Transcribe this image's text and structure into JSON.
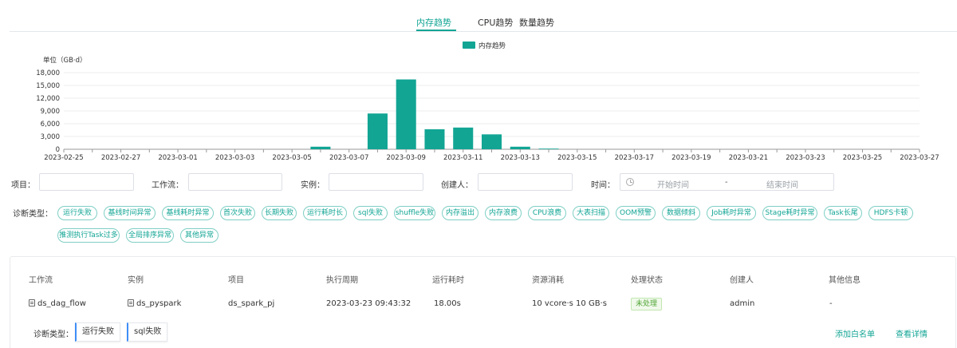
{
  "tabs": [
    {
      "label": "内存趋势"
    },
    {
      "label": "CPU趋势"
    },
    {
      "label": "数量趋势"
    }
  ],
  "colors": {
    "accent": "#12a594",
    "bar": "#12a594",
    "status_ok": "#52a538",
    "chip_border": "#3e8ef7"
  },
  "chart_data": {
    "type": "bar",
    "title": "",
    "legend": [
      "内存趋势"
    ],
    "legend_position": "top-center",
    "ylabel": "单位（GB·d）",
    "ylim": [
      0,
      18000
    ],
    "yticks": [
      "18,000",
      "15,000",
      "12,000",
      "9,000",
      "6,000",
      "3,000",
      "0"
    ],
    "grid": true,
    "xtick_labels": [
      "2023-02-25",
      "2023-02-27",
      "2023-03-01",
      "2023-03-03",
      "2023-03-05",
      "2023-03-07",
      "2023-03-09",
      "2023-03-11",
      "2023-03-13",
      "2023-03-15",
      "2023-03-17",
      "2023-03-19",
      "2023-03-21",
      "2023-03-23",
      "2023-03-25",
      "2023-03-27"
    ],
    "categories": [
      "2023-02-25",
      "2023-02-26",
      "2023-02-27",
      "2023-02-28",
      "2023-03-01",
      "2023-03-02",
      "2023-03-03",
      "2023-03-04",
      "2023-03-05",
      "2023-03-06",
      "2023-03-07",
      "2023-03-08",
      "2023-03-09",
      "2023-03-10",
      "2023-03-11",
      "2023-03-12",
      "2023-03-13",
      "2023-03-14",
      "2023-03-15",
      "2023-03-16",
      "2023-03-17",
      "2023-03-18",
      "2023-03-19",
      "2023-03-20",
      "2023-03-21",
      "2023-03-22",
      "2023-03-23",
      "2023-03-24",
      "2023-03-25",
      "2023-03-26",
      "2023-03-27"
    ],
    "series": [
      {
        "name": "内存趋势",
        "values": [
          0,
          0,
          0,
          0,
          0,
          0,
          0,
          0,
          0,
          600,
          0,
          8400,
          16400,
          4700,
          5100,
          3500,
          600,
          150,
          0,
          0,
          0,
          0,
          0,
          0,
          0,
          0,
          0,
          0,
          0,
          0,
          0
        ]
      }
    ]
  },
  "filters": {
    "project_label": "项目：",
    "workflow_label": "工作流：",
    "instance_label": "实例：",
    "creator_label": "创建人：",
    "time_label": "时间：",
    "start_placeholder": "开始时间",
    "range_sep": "-",
    "end_placeholder": "结束时间",
    "diag_label": "诊断类型："
  },
  "diag_tags": [
    "运行失败",
    "基线时间异常",
    "基线耗时异常",
    "首次失败",
    "长期失败",
    "运行耗时长",
    "sql失败",
    "shuffle失败",
    "内存溢出",
    "内存浪费",
    "CPU浪费",
    "大表扫描",
    "OOM预警",
    "数据倾斜",
    "Job耗时异常",
    "Stage耗时异常",
    "Task长尾",
    "HDFS卡顿",
    "推测执行Task过多",
    "全局排序异常",
    "其他异常"
  ],
  "table": {
    "headers": [
      "工作流",
      "实例",
      "项目",
      "执行周期",
      "运行耗时",
      "资源消耗",
      "处理状态",
      "创建人",
      "其他信息"
    ],
    "row": {
      "workflow": "ds_dag_flow",
      "instance": "ds_pyspark",
      "project": "ds_spark_pj",
      "period": "2023-03-23 09:43:32",
      "duration": "18.00s",
      "resource": "10 vcore·s 10 GB·s",
      "status": "未处理",
      "creator": "admin",
      "other": "-",
      "diag_label": "诊断类型：",
      "diag_types": [
        "运行失败",
        "sql失败"
      ],
      "add_whitelist": "添加白名单",
      "view_detail": "查看详情"
    }
  }
}
